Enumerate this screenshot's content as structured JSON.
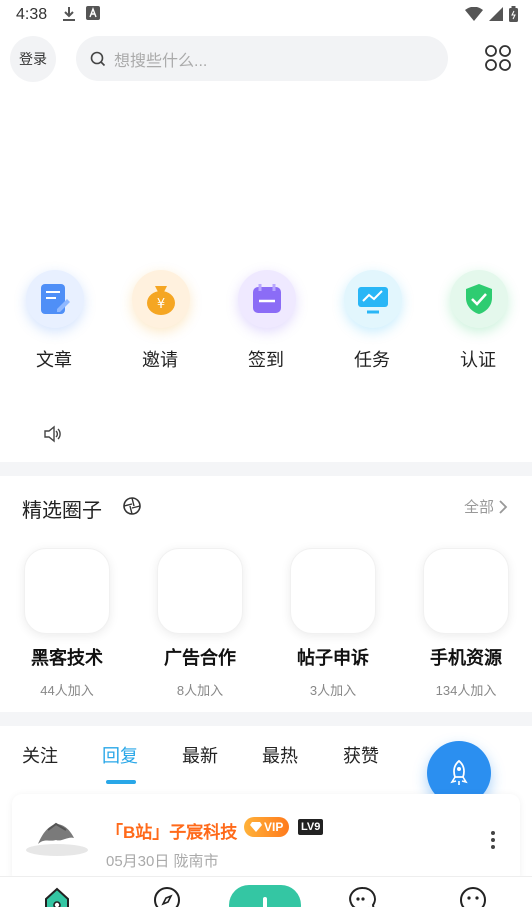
{
  "status_bar": {
    "time": "4:38",
    "icons": [
      "download-icon",
      "text-a-icon",
      "wifi-icon",
      "signal-icon",
      "battery-icon"
    ]
  },
  "header": {
    "login_label": "登录",
    "search_placeholder": "想搜些什么..."
  },
  "quick_actions": [
    {
      "label": "文章",
      "icon": "article-edit-icon",
      "color": "#4f8ff7"
    },
    {
      "label": "邀请",
      "icon": "money-bag-icon",
      "color": "#f5a623"
    },
    {
      "label": "签到",
      "icon": "calendar-icon",
      "color": "#8b6cf6"
    },
    {
      "label": "任务",
      "icon": "monitor-chart-icon",
      "color": "#29b6f6"
    },
    {
      "label": "认证",
      "icon": "shield-check-icon",
      "color": "#2ecc71"
    }
  ],
  "circles_section": {
    "title": "精选圈子",
    "see_all": "全部",
    "items": [
      {
        "name": "黑客技术",
        "members": "44人加入"
      },
      {
        "name": "广告合作",
        "members": "8人加入"
      },
      {
        "name": "帖子申诉",
        "members": "3人加入"
      },
      {
        "name": "手机资源",
        "members": "134人加入"
      }
    ]
  },
  "feed_tabs": {
    "items": [
      "关注",
      "回复",
      "最新",
      "最热",
      "获赞"
    ],
    "active": "回复"
  },
  "feed": {
    "post": {
      "author": "「B站」子宸科技",
      "vip_label": "VIP",
      "level_label": "LV9",
      "meta": "05月30日 陇南市"
    }
  },
  "colors": {
    "accent": "#29a7e8",
    "fab": "#2b8ff0",
    "nav_center": "#34c6a3",
    "author": "#ff6a1a"
  }
}
